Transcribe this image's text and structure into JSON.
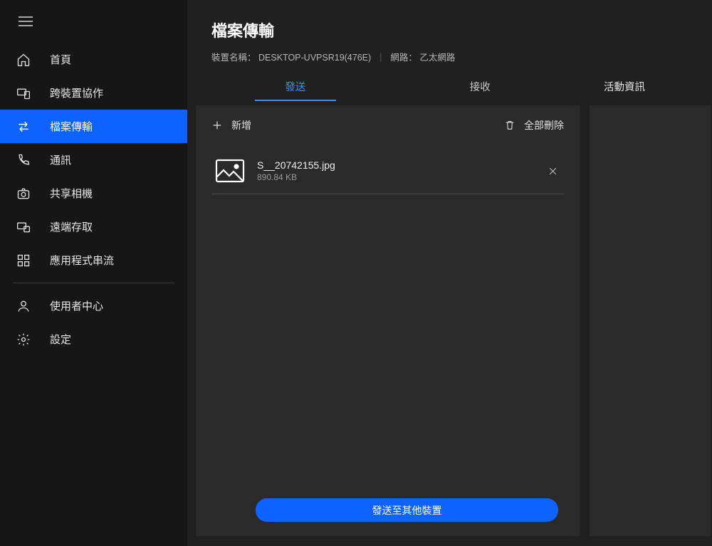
{
  "sidebar": {
    "items": [
      {
        "id": "home",
        "label": "首頁"
      },
      {
        "id": "cross",
        "label": "跨裝置協作"
      },
      {
        "id": "transfer",
        "label": "檔案傳輸"
      },
      {
        "id": "comm",
        "label": "通訊"
      },
      {
        "id": "camera",
        "label": "共享相機"
      },
      {
        "id": "remote",
        "label": "遠端存取"
      },
      {
        "id": "stream",
        "label": "應用程式串流"
      }
    ],
    "footer": [
      {
        "id": "user",
        "label": "使用者中心"
      },
      {
        "id": "settings",
        "label": "設定"
      }
    ]
  },
  "header": {
    "title": "檔案傳輸",
    "device_label": "裝置名稱：",
    "device_value": "DESKTOP-UVPSR19(476E)",
    "network_label": "網路：",
    "network_value": "乙太網路"
  },
  "tabs": {
    "send": "發送",
    "receive": "接收"
  },
  "toolbar": {
    "add": "新增",
    "delete_all": "全部刪除"
  },
  "files": [
    {
      "name": "S__20742155.jpg",
      "size": "890.84 KB"
    }
  ],
  "activity": {
    "title": "活動資訊"
  },
  "action_button": "發送至其他裝置"
}
